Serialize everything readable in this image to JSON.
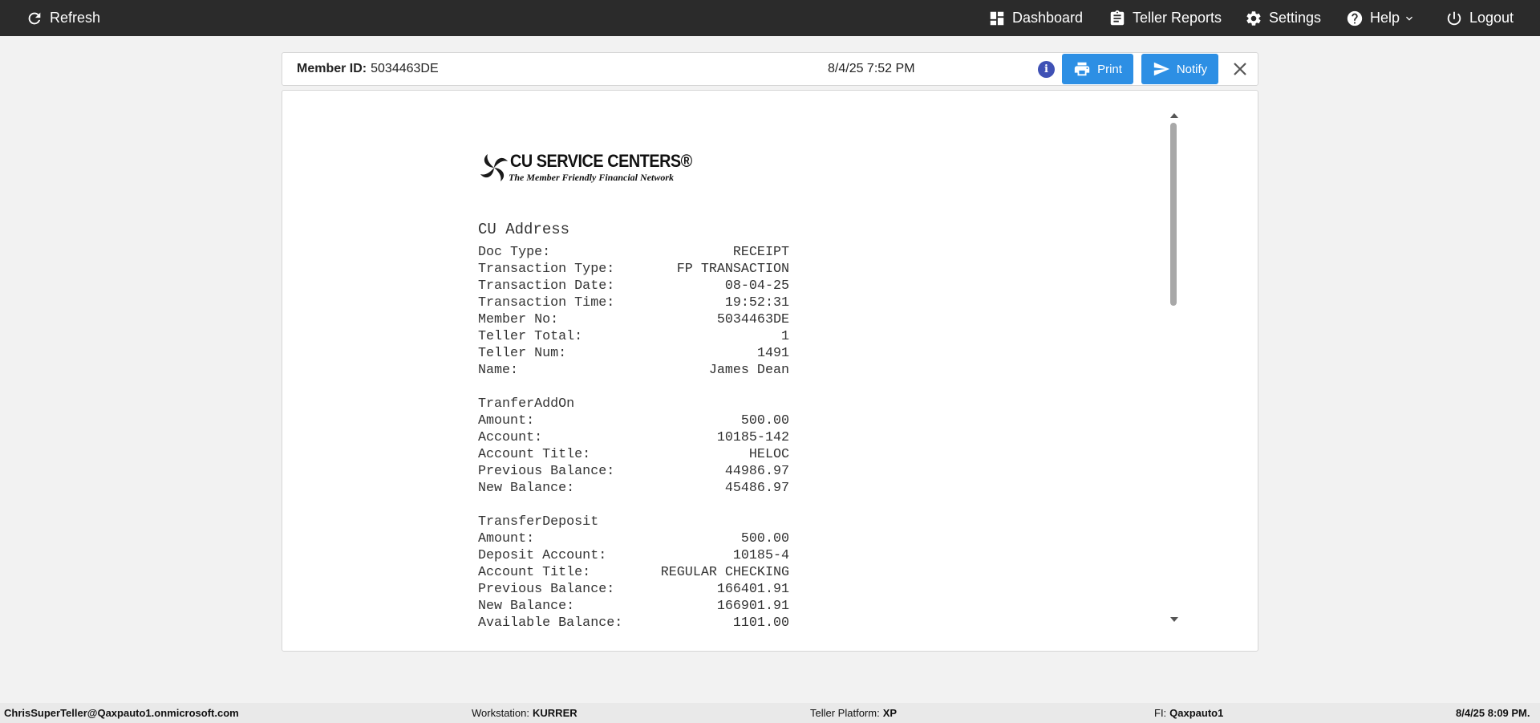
{
  "nav": {
    "refresh": "Refresh",
    "dashboard": "Dashboard",
    "teller_reports": "Teller Reports",
    "settings": "Settings",
    "help": "Help",
    "logout": "Logout"
  },
  "header": {
    "member_id_label": "Member ID:",
    "member_id_value": "5034463DE",
    "datetime": "8/4/25 7:52 PM",
    "print_label": "Print",
    "notify_label": "Notify"
  },
  "receipt": {
    "logo_line1": "CU SERVICE CENTERS®",
    "logo_line2": "The Member Friendly Financial Network",
    "cu_address": "CU Address",
    "header_rows": [
      {
        "label": "Doc Type:",
        "value": "RECEIPT"
      },
      {
        "label": "Transaction Type:",
        "value": "FP TRANSACTION"
      },
      {
        "label": "Transaction Date:",
        "value": "08-04-25"
      },
      {
        "label": "Transaction Time:",
        "value": "19:52:31"
      },
      {
        "label": "Member No:",
        "value": "5034463DE"
      },
      {
        "label": "Teller Total:",
        "value": "1"
      },
      {
        "label": "Teller Num:",
        "value": "1491"
      },
      {
        "label": "Name:",
        "value": "James Dean"
      }
    ],
    "section1_title": "TranferAddOn",
    "section1_rows": [
      {
        "label": "Amount:",
        "value": "500.00"
      },
      {
        "label": "Account:",
        "value": "10185-142"
      },
      {
        "label": "Account Title:",
        "value": "HELOC"
      },
      {
        "label": "Previous Balance:",
        "value": "44986.97"
      },
      {
        "label": "New Balance:",
        "value": "45486.97"
      }
    ],
    "section2_title": "TransferDeposit",
    "section2_rows": [
      {
        "label": "Amount:",
        "value": "500.00"
      },
      {
        "label": "Deposit Account:",
        "value": "10185-4"
      },
      {
        "label": "Account Title:",
        "value": "REGULAR CHECKING"
      },
      {
        "label": "Previous Balance:",
        "value": "166401.91"
      },
      {
        "label": "New Balance:",
        "value": "166901.91"
      },
      {
        "label": "Available Balance:",
        "value": "1101.00"
      }
    ]
  },
  "status": {
    "user": "ChrisSuperTeller@Qaxpauto1.onmicrosoft.com",
    "workstation_label": "Workstation:",
    "workstation_value": "KURRER",
    "platform_label": "Teller Platform:",
    "platform_value": "XP",
    "fi_label": "FI:",
    "fi_value": "Qaxpauto1",
    "time": "8/4/25 8:09 PM."
  },
  "colors": {
    "topbar": "#2b2b2b",
    "button_blue": "#2d8fe4",
    "info_icon": "#3f51b5"
  }
}
